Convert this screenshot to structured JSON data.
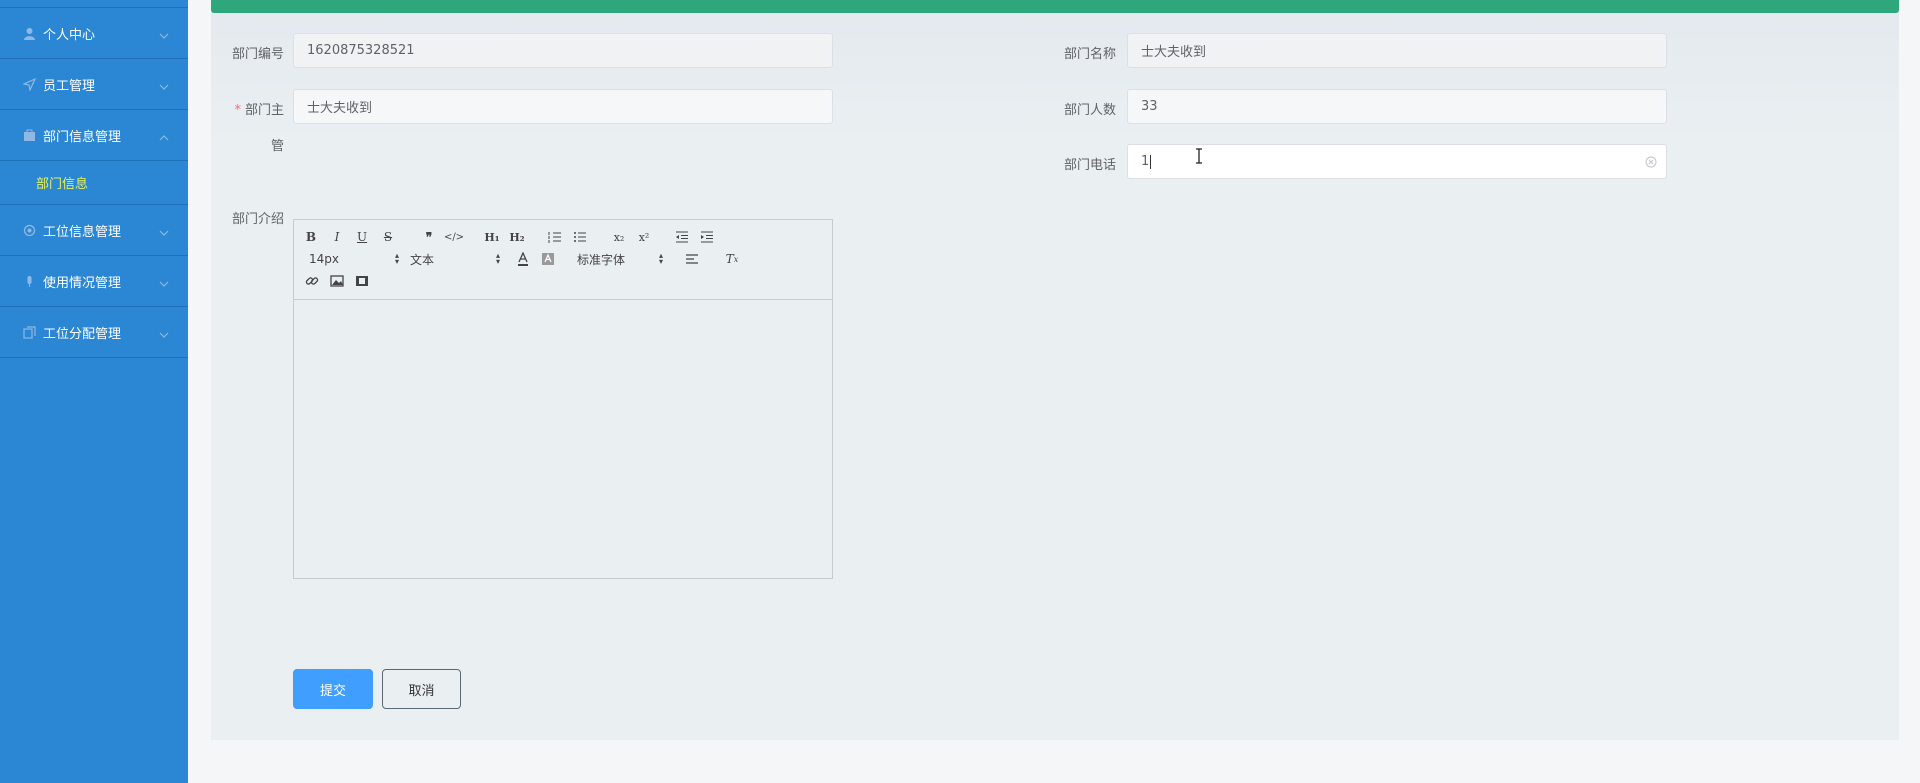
{
  "sidebar": {
    "items": [
      {
        "label": "个人中心",
        "icon": "user-icon"
      },
      {
        "label": "员工管理",
        "icon": "send-icon"
      },
      {
        "label": "部门信息管理",
        "icon": "briefcase-icon"
      },
      {
        "label": "工位信息管理",
        "icon": "gear-icon"
      },
      {
        "label": "使用情况管理",
        "icon": "microphone-icon"
      },
      {
        "label": "工位分配管理",
        "icon": "copy-icon"
      }
    ],
    "sub_item": "部门信息"
  },
  "form": {
    "dept_no_label": "部门编号",
    "dept_no_value": "1620875328521",
    "dept_name_label": "部门名称",
    "dept_name_value": "士大夫收到",
    "dept_head_label_1": "部门主",
    "dept_head_label_2": "管",
    "dept_head_required": "*",
    "dept_head_value": "士大夫收到",
    "dept_count_label": "部门人数",
    "dept_count_value": "33",
    "dept_phone_label": "部门电话",
    "dept_phone_value": "1",
    "dept_intro_label": "部门介绍"
  },
  "editor": {
    "font_size": "14px",
    "text_type": "文本",
    "font_family": "标准字体"
  },
  "buttons": {
    "submit": "提交",
    "cancel": "取消"
  },
  "colors": {
    "sidebar_bg": "#2b86d3",
    "topbar": "#2fa77c",
    "active_sub": "#e6f25a",
    "primary": "#409eff"
  }
}
